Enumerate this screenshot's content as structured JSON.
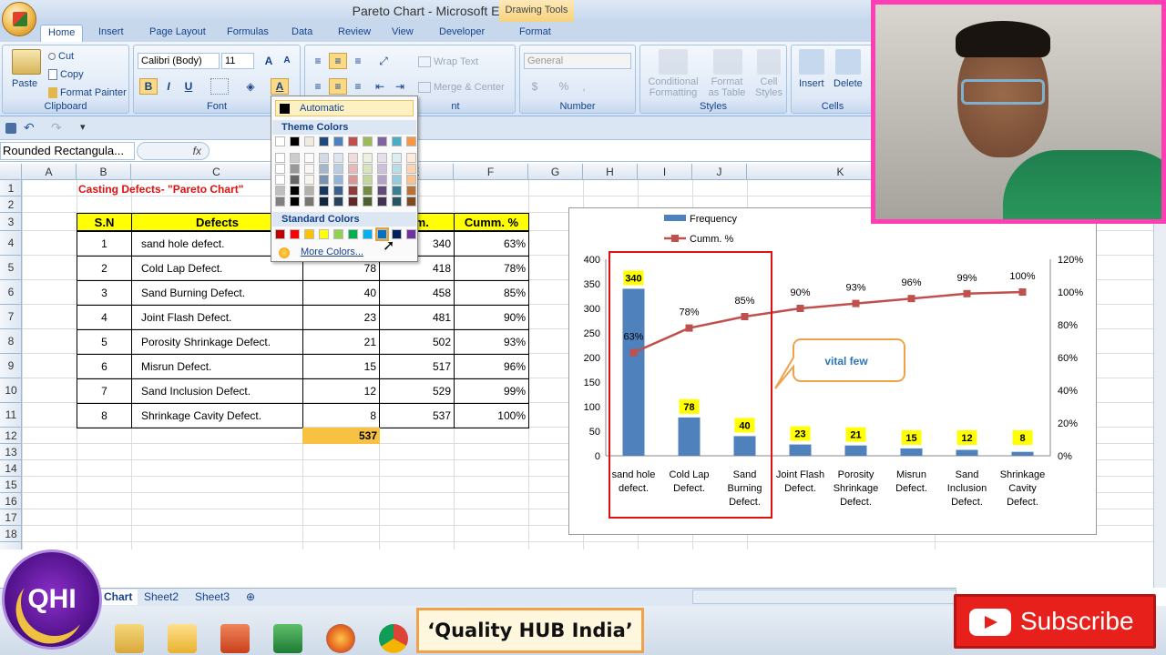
{
  "window": {
    "title": "Pareto Chart - Microsoft Excel",
    "contextual_tab": "Drawing Tools"
  },
  "ribbon_tabs": [
    "Home",
    "Insert",
    "Page Layout",
    "Formulas",
    "Data",
    "Review",
    "View",
    "Developer",
    "Format"
  ],
  "clipboard": {
    "paste": "Paste",
    "cut": "Cut",
    "copy": "Copy",
    "format_painter": "Format Painter",
    "label": "Clipboard"
  },
  "font": {
    "name": "Calibri (Body)",
    "size": "11",
    "label": "Font",
    "bold": "B",
    "italic": "I",
    "underline": "U",
    "font_color": "A"
  },
  "alignment": {
    "wrap": "Wrap Text",
    "merge": "Merge & Center",
    "label": "nt"
  },
  "number": {
    "format": "General",
    "label": "Number",
    "currency": "$",
    "percent": "%",
    "comma": ","
  },
  "styles": {
    "conditional": "Conditional",
    "conditional2": "Formatting",
    "format_table": "Format",
    "format_table2": "as Table",
    "cell_styles": "Cell",
    "cell_styles2": "Styles",
    "label": "Styles"
  },
  "cells": {
    "insert": "Insert",
    "delete": "Delete",
    "label": "Cells"
  },
  "namebox": "Rounded Rectangula...",
  "fx": "fx",
  "columns": [
    "A",
    "B",
    "C",
    "D",
    "E",
    "F",
    "G",
    "H",
    "I",
    "J",
    "K"
  ],
  "rows": [
    "1",
    "2",
    "3",
    "4",
    "5",
    "6",
    "7",
    "8",
    "9",
    "10",
    "11",
    "12",
    "13",
    "14",
    "15",
    "16",
    "17",
    "18"
  ],
  "sheet": {
    "title": "Casting Defects- \"Pareto Chart\"",
    "headers": {
      "sn": "S.N",
      "defects": "Defects",
      "freq": "",
      "cumm": "mm.",
      "cumm_pct": "Cumm. %"
    },
    "table": [
      {
        "sn": "1",
        "defect": "sand hole defect.",
        "freq": "",
        "cumm": "340",
        "pct": "63%"
      },
      {
        "sn": "2",
        "defect": "Cold Lap Defect.",
        "freq": "78",
        "cumm": "418",
        "pct": "78%"
      },
      {
        "sn": "3",
        "defect": "Sand Burning Defect.",
        "freq": "40",
        "cumm": "458",
        "pct": "85%"
      },
      {
        "sn": "4",
        "defect": "Joint Flash Defect.",
        "freq": "23",
        "cumm": "481",
        "pct": "90%"
      },
      {
        "sn": "5",
        "defect": "Porosity Shrinkage Defect.",
        "freq": "21",
        "cumm": "502",
        "pct": "93%"
      },
      {
        "sn": "6",
        "defect": "Misrun Defect.",
        "freq": "15",
        "cumm": "517",
        "pct": "96%"
      },
      {
        "sn": "7",
        "defect": "Sand Inclusion Defect.",
        "freq": "12",
        "cumm": "529",
        "pct": "99%"
      },
      {
        "sn": "8",
        "defect": "Shrinkage Cavity Defect.",
        "freq": "8",
        "cumm": "537",
        "pct": "100%"
      }
    ],
    "total": "537"
  },
  "color_popup": {
    "automatic": "Automatic",
    "theme_label": "Theme Colors",
    "standard_label": "Standard Colors",
    "more": "More Colors...",
    "theme_top": [
      "#ffffff",
      "#000000",
      "#eeece1",
      "#1f497d",
      "#4f81bd",
      "#c0504d",
      "#9bbb59",
      "#8064a2",
      "#4bacc6",
      "#f79646"
    ],
    "standard": [
      "#c00000",
      "#ff0000",
      "#ffc000",
      "#ffff00",
      "#92d050",
      "#00b050",
      "#00b0f0",
      "#0070c0",
      "#002060",
      "#7030a0"
    ]
  },
  "chart_data": {
    "type": "bar",
    "categories": [
      "sand hole defect.",
      "Cold Lap Defect.",
      "Sand Burning Defect.",
      "Joint Flash Defect.",
      "Porosity Shrinkage Defect.",
      "Misrun Defect.",
      "Sand Inclusion Defect.",
      "Shrinkage Cavity Defect."
    ],
    "series": [
      {
        "name": "Frequency",
        "type": "bar",
        "values": [
          340,
          78,
          40,
          23,
          21,
          15,
          12,
          8
        ],
        "color": "#4f81bd"
      },
      {
        "name": "Cumm. %",
        "type": "line",
        "values": [
          63,
          78,
          85,
          90,
          93,
          96,
          99,
          100
        ],
        "color": "#c0504d",
        "axis": "secondary"
      }
    ],
    "y_ticks": [
      "0",
      "50",
      "100",
      "150",
      "200",
      "250",
      "300",
      "350",
      "400"
    ],
    "y2_ticks": [
      "0%",
      "20%",
      "40%",
      "60%",
      "80%",
      "100%",
      "120%"
    ],
    "ylim": [
      0,
      400
    ],
    "y2lim": [
      0,
      120
    ],
    "bar_labels": [
      "340",
      "78",
      "40",
      "23",
      "21",
      "15",
      "12",
      "8"
    ],
    "line_labels": [
      "63%",
      "78%",
      "85%",
      "90%",
      "93%",
      "96%",
      "99%",
      "100%"
    ],
    "annotation": "vital few",
    "legend_position": "top-left"
  },
  "sheet_tabs": [
    "Chart",
    "Sheet2",
    "Sheet3"
  ],
  "overlay": {
    "logo": "QHI",
    "banner": "‘Quality HUB India’",
    "subscribe": "Subscribe"
  }
}
